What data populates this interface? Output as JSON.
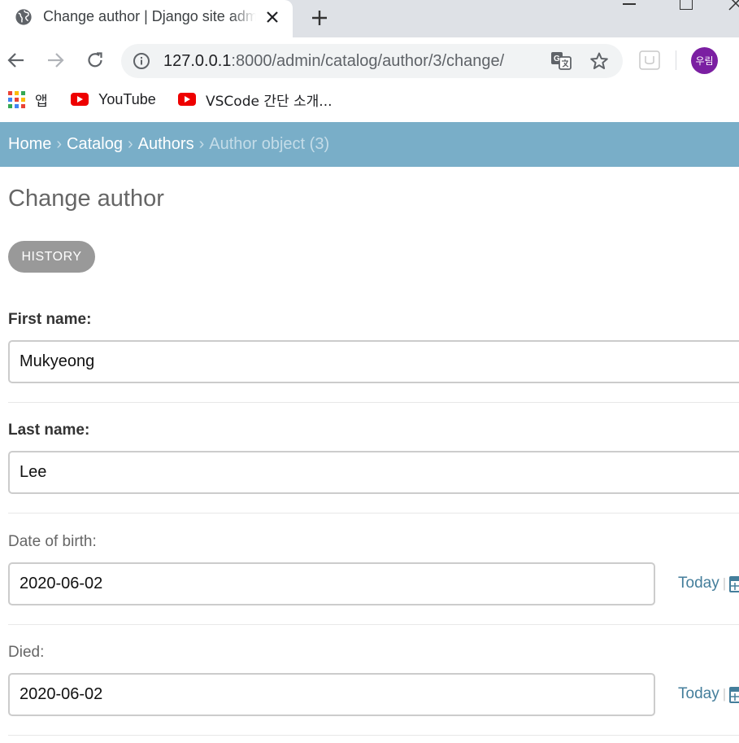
{
  "browser": {
    "tab_title": "Change author | Django site admin",
    "url_host": "127.0.0.1",
    "url_path": ":8000/admin/catalog/author/3/change/",
    "profile_label": "우림",
    "bookmarks": [
      {
        "label": "앱",
        "icon": "apps-grid-icon"
      },
      {
        "label": "YouTube",
        "icon": "youtube-icon"
      },
      {
        "label": "VSCode 간단 소개...",
        "icon": "youtube-icon"
      }
    ]
  },
  "breadcrumbs": {
    "home": "Home",
    "catalog": "Catalog",
    "authors": "Authors",
    "current": "Author object (3)",
    "separator": "›"
  },
  "page": {
    "title": "Change author",
    "history_button": "HISTORY"
  },
  "form": {
    "first_name": {
      "label": "First name:",
      "value": "Mukyeong"
    },
    "last_name": {
      "label": "Last name:",
      "value": "Lee"
    },
    "date_of_birth": {
      "label": "Date of birth:",
      "value": "2020-06-02",
      "today_label": "Today"
    },
    "died": {
      "label": "Died:",
      "value": "2020-06-02",
      "today_label": "Today"
    }
  },
  "colors": {
    "breadcrumb_bar": "#79aec8",
    "link": "#447e9b",
    "history_button": "#999999",
    "profile_avatar": "#7b1fa2"
  }
}
